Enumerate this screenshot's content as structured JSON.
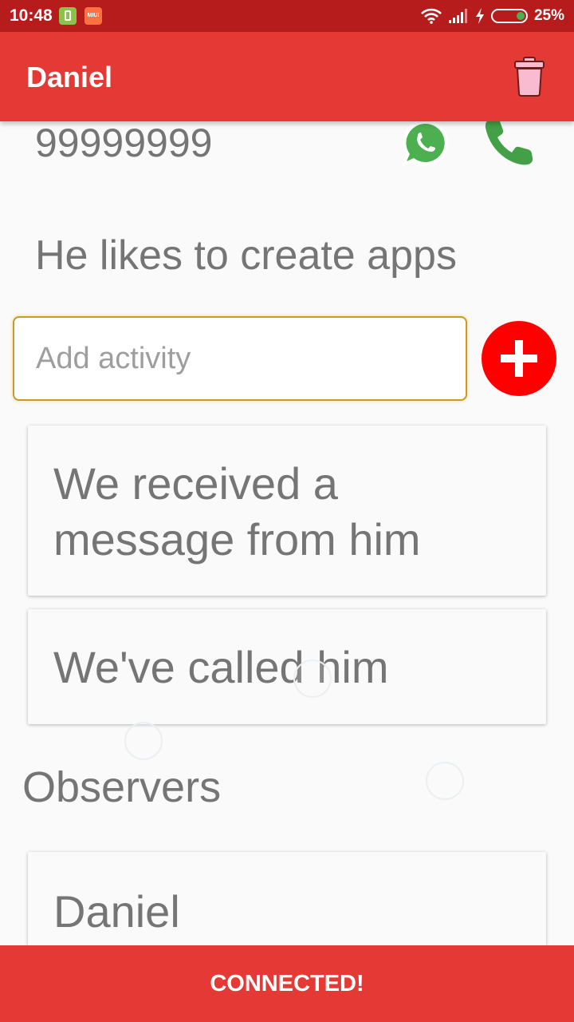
{
  "status_bar": {
    "time": "10:48",
    "battery_percent": "25%",
    "icons": [
      "phone-app-icon",
      "miui-app-icon",
      "wifi-icon",
      "signal-icon",
      "charging-icon",
      "battery-icon"
    ],
    "miui_label": "MIUI"
  },
  "app_bar": {
    "title": "Daniel",
    "action_icon": "trash-icon",
    "color": "#e53935"
  },
  "contact": {
    "phone": "99999999",
    "description": "He likes to create apps"
  },
  "activity_form": {
    "placeholder": "Add activity",
    "value": "",
    "add_icon": "plus-icon"
  },
  "activities": [
    {
      "text": "We received a message from him"
    },
    {
      "text": "We've called him"
    }
  ],
  "observers": {
    "heading": "Observers",
    "items": [
      {
        "name": "Daniel"
      }
    ]
  },
  "snackbar": {
    "message": "CONNECTED!"
  },
  "colors": {
    "status_bar": "#b71c1c",
    "accent": "#e53935",
    "add_button": "#ff0000",
    "whatsapp": "#4caf50",
    "call": "#43a047",
    "text": "#757575"
  }
}
